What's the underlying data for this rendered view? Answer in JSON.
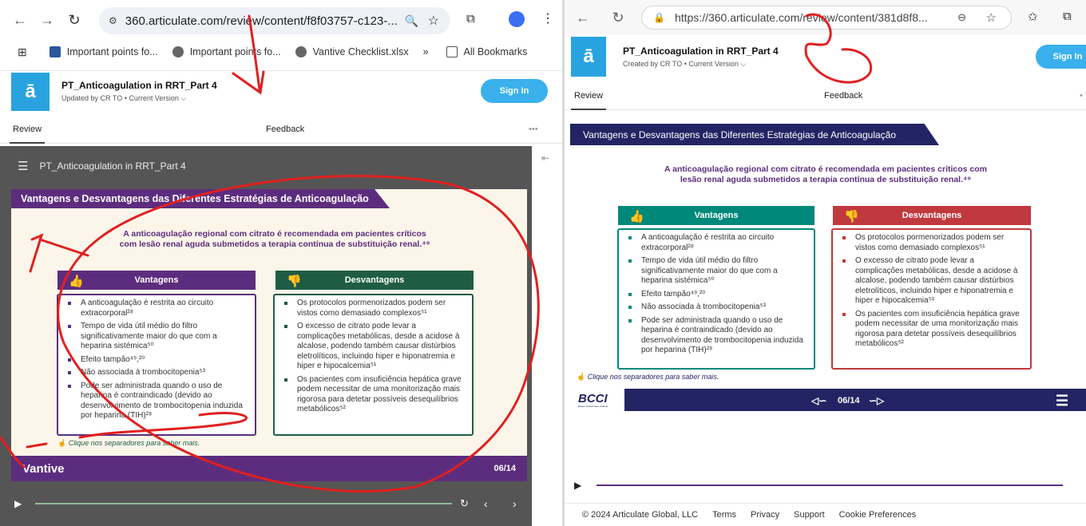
{
  "left": {
    "url": "360.articulate.com/review/content/f8f03757-c123-...",
    "bookmarks": [
      {
        "label": "Important points fo...",
        "icon": "word-doc-icon"
      },
      {
        "label": "Important points fo...",
        "icon": "globe-icon"
      },
      {
        "label": "Vantive Checklist.xlsx",
        "icon": "globe-icon"
      }
    ],
    "all_bookmarks": "All Bookmarks",
    "title": "PT_Anticoagulation in RRT_Part 4",
    "meta": "Updated by CR TO  •  Current Version ⌵",
    "signin": "Sign In",
    "tab_review": "Review",
    "tab_feedback": "Feedback",
    "player_title": "PT_Anticoagulation in RRT_Part 4",
    "footer_brand": "Vantive",
    "page": "06/14"
  },
  "right": {
    "url": "https://360.articulate.com/review/content/381d8f8...",
    "title": "PT_Anticoagulation in RRT_Part 4",
    "meta": "Created by CR TO  •  Current Version ⌵",
    "signin": "Sign In",
    "tab_review": "Review",
    "tab_feedback": "Feedback",
    "footer_brand": "BCCI",
    "footer_tagline": "Baxter Critical Care Institute",
    "page": "06/14",
    "copyright": "© 2024 Articulate Global, LLC",
    "links": [
      "Terms",
      "Privacy",
      "Support",
      "Cookie Preferences"
    ]
  },
  "slide": {
    "heading": "Vantagens e Desvantagens das Diferentes Estratégias de Anticoagulação",
    "intro_l1": "A anticoagulação regional com citrato é recomendada em pacientes críticos",
    "intro_l2": "com lesão renal aguda submetidos a terapia contínua de substituição renal.⁴⁹",
    "intro_r1": "A anticoagulação regional com citrato é recomendada em pacientes críticos com",
    "intro_r2": "lesão renal aguda submetidos a terapia contínua de substituição renal.⁴⁹",
    "adv_title": "Vantagens",
    "dis_title": "Desvantagens",
    "advantages": [
      "A anticoagulação é restrita ao circuito extracorporal²⁸",
      "Tempo de vida útil médio do filtro significativamente maior do que com a heparina sistémica⁵⁰",
      "Efeito tampão⁴⁹,²⁰",
      "Não associada à trombocitopenia⁵³",
      "Pode ser administrada quando o uso de heparina é contraindicado (devido ao desenvolvimento de trombocitopenia induzida por heparina (TIH)²⁸"
    ],
    "disadvantages": [
      "Os protocolos pormenorizados podem ser vistos como demasiado complexos⁵¹",
      "O excesso de citrato pode levar a complicações metabólicas, desde a acidose à alcalose, podendo também causar distúrbios eletrolíticos, incluindo hiper e hiponatremia e hiper e hipocalcemia⁵¹",
      "Os pacientes com insuficiência hepática grave podem necessitar de uma monitorização mais rigorosa para detetar possíveis desequilíbrios metabólicos⁵²"
    ],
    "hint": "Clique nos separadores para saber mais."
  },
  "colors": {
    "left_purple": "#5c2d7e",
    "left_green": "#1f5c45",
    "right_teal": "#00897b",
    "right_red": "#c0393f",
    "right_navy": "#232463",
    "annotation": "#e02020"
  }
}
